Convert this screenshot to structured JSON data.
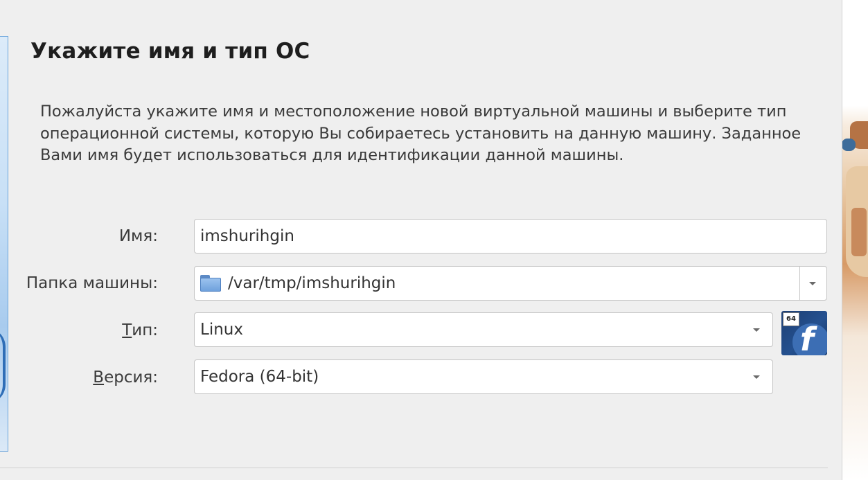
{
  "dialog": {
    "title": "Укажите имя и тип ОС",
    "description": "Пожалуйста укажите имя и местоположение новой виртуальной машины и выберите тип операционной системы, которую Вы собираетесь установить на данную машину. Заданное Вами имя будет использоваться для идентификации данной машины."
  },
  "form": {
    "name": {
      "label": "Имя:",
      "value": "imshurihgin"
    },
    "machine_folder": {
      "label": "Папка машины:",
      "value": "/var/tmp/imshurihgin",
      "icon": "folder-icon"
    },
    "type": {
      "label_mnemonic": "Т",
      "label_rest": "ип:",
      "value": "Linux"
    },
    "version": {
      "label_mnemonic": "В",
      "label_rest": "ерсия:",
      "value": "Fedora (64-bit)"
    }
  },
  "os_icon": {
    "name": "fedora-64-icon",
    "badge": "64",
    "glyph": "f"
  }
}
